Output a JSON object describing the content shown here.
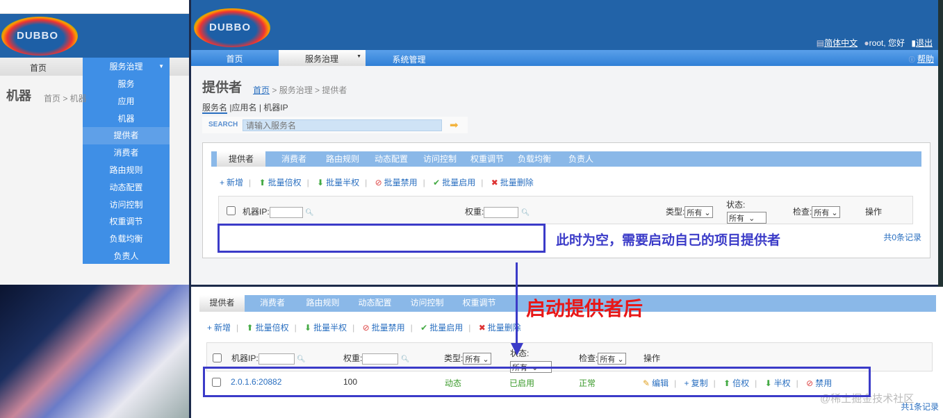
{
  "logo_text": "DUBBO",
  "left": {
    "nav_home": "首页",
    "nav_governance": "服务治理",
    "page_title": "机器",
    "breadcrumb": "首页 > 机器",
    "menu": [
      "服务",
      "应用",
      "机器",
      "提供者",
      "消费者",
      "路由规则",
      "动态配置",
      "访问控制",
      "权重调节",
      "负载均衡",
      "负责人"
    ],
    "active_menu": "提供者"
  },
  "header": {
    "lang": "简体中文",
    "user": "root, 您好",
    "logout": "退出",
    "help": "帮助"
  },
  "nav": {
    "home": "首页",
    "governance": "服务治理",
    "system": "系统管理"
  },
  "page": {
    "title": "提供者",
    "breadcrumb_home": "首页",
    "breadcrumb_rest": "> 服务治理 > 提供者",
    "search_tabs": [
      "服务名",
      "应用名",
      "机器IP"
    ],
    "search_label": "SEARCH",
    "search_placeholder": "请输入服务名"
  },
  "tabs": [
    "提供者",
    "消费者",
    "路由规则",
    "动态配置",
    "访问控制",
    "权重调节",
    "负载均衡",
    "负责人"
  ],
  "actions": [
    "新增",
    "批量倍权",
    "批量半权",
    "批量禁用",
    "批量启用",
    "批量删除"
  ],
  "filters": {
    "ip": "机器IP:",
    "weight": "权重:",
    "type": "类型:",
    "status": "状态:",
    "check": "检查:",
    "ops": "操作",
    "all": "所有"
  },
  "empty_count": "共0条记录",
  "annotation_empty": "此时为空，需要启动自己的项目提供者",
  "annotation_after": "启动提供者后",
  "row": {
    "address": "2.0.1.6:20882",
    "weight": "100",
    "type": "动态",
    "status": "已启用",
    "check": "正常",
    "ops": [
      "编辑",
      "复制",
      "倍权",
      "半权",
      "禁用"
    ]
  },
  "after_count": "共1条记录",
  "watermark": "@稀土掘金技术社区",
  "colors": {
    "header": "#2263a8",
    "annotation_blue": "#3b3bc8",
    "annotation_red": "#e81818"
  }
}
